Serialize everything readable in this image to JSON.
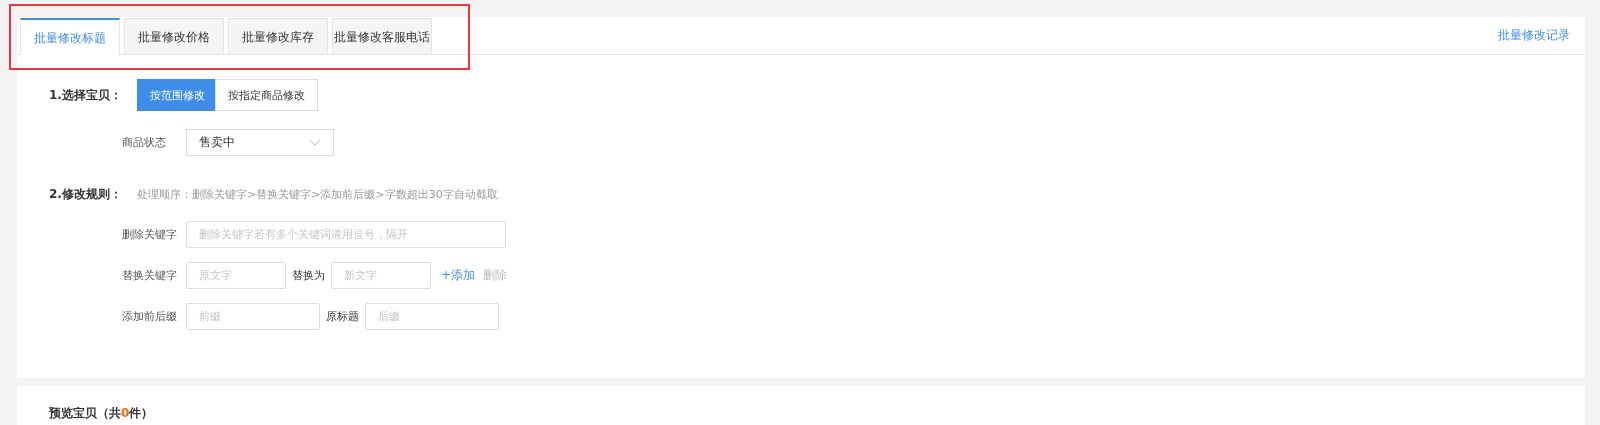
{
  "tabs": [
    {
      "label": "批量修改标题",
      "selected": true
    },
    {
      "label": "批量修改价格",
      "selected": false
    },
    {
      "label": "批量修改库存",
      "selected": false
    },
    {
      "label": "批量修改客服电话",
      "selected": false
    }
  ],
  "history_link": "批量修改记录",
  "step1": {
    "label": "1.选择宝贝：",
    "modes": [
      {
        "label": "按范围修改",
        "selected": true
      },
      {
        "label": "按指定商品修改",
        "selected": false
      }
    ],
    "status": {
      "label": "商品状态",
      "value": "售卖中"
    }
  },
  "step2": {
    "label": "2.修改规则：",
    "hint": "处理顺序：删除关键字>替换关键字>添加前后缀>字数超出30字自动截取",
    "delete": {
      "label": "删除关键字",
      "placeholder": "删除关键字若有多个关键词请用逗号，隔开"
    },
    "replace": {
      "label": "替换关键字",
      "from_placeholder": "原文字",
      "to_label": "替换为",
      "to_placeholder": "新文字",
      "add": "+添加",
      "remove": "删除"
    },
    "affix": {
      "label": "添加前后缀",
      "prefix_placeholder": "前缀",
      "middle": "原标题",
      "suffix_placeholder": "后缀"
    }
  },
  "preview": {
    "before": "预览宝贝（共",
    "count": "0",
    "after": "件）"
  }
}
